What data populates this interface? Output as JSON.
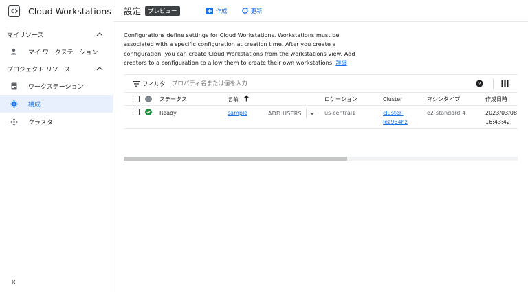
{
  "app": {
    "title": "Cloud Workstations"
  },
  "sidebar": {
    "sections": [
      {
        "label": "マイリソース",
        "items": [
          {
            "label": "マイ ワークステーション",
            "icon": "person-icon"
          }
        ]
      },
      {
        "label": "プロジェクト リソース",
        "items": [
          {
            "label": "ワークステーション",
            "icon": "clipboard-icon"
          },
          {
            "label": "構成",
            "icon": "gear-icon",
            "active": true
          },
          {
            "label": "クラスタ",
            "icon": "move-icon"
          }
        ]
      }
    ]
  },
  "header": {
    "title": "設定",
    "badge": "プレビュー",
    "create_label": "作成",
    "refresh_label": "更新"
  },
  "description": {
    "text": "Configurations define settings for Cloud Workstations. Workstations must be associated with a specific configuration at creation time. After you create a configuration, you can create Cloud Workstations from the workstations view. Add creators to a configuration to allow them to create their own workstations.",
    "link": "詳細"
  },
  "filter": {
    "label": "フィルタ",
    "placeholder": "プロパティ名または値を入力"
  },
  "table": {
    "columns": {
      "status": "ステータス",
      "name": "名前",
      "location": "ロケーション",
      "cluster": "Cluster",
      "machine": "マシンタイプ",
      "created": "作成日時"
    },
    "rows": [
      {
        "status": "Ready",
        "name": "sample",
        "add_users": "ADD USERS",
        "location": "us-central1",
        "cluster_line1": "cluster-",
        "cluster_line2": "lez934hz",
        "machine": "e2-standard-4",
        "created_date": "2023/03/08",
        "created_time": "16:43:42"
      }
    ]
  },
  "colors": {
    "accent": "#1a73e8",
    "ok": "#1e8e3e",
    "active_bg": "#e8f0fe"
  }
}
